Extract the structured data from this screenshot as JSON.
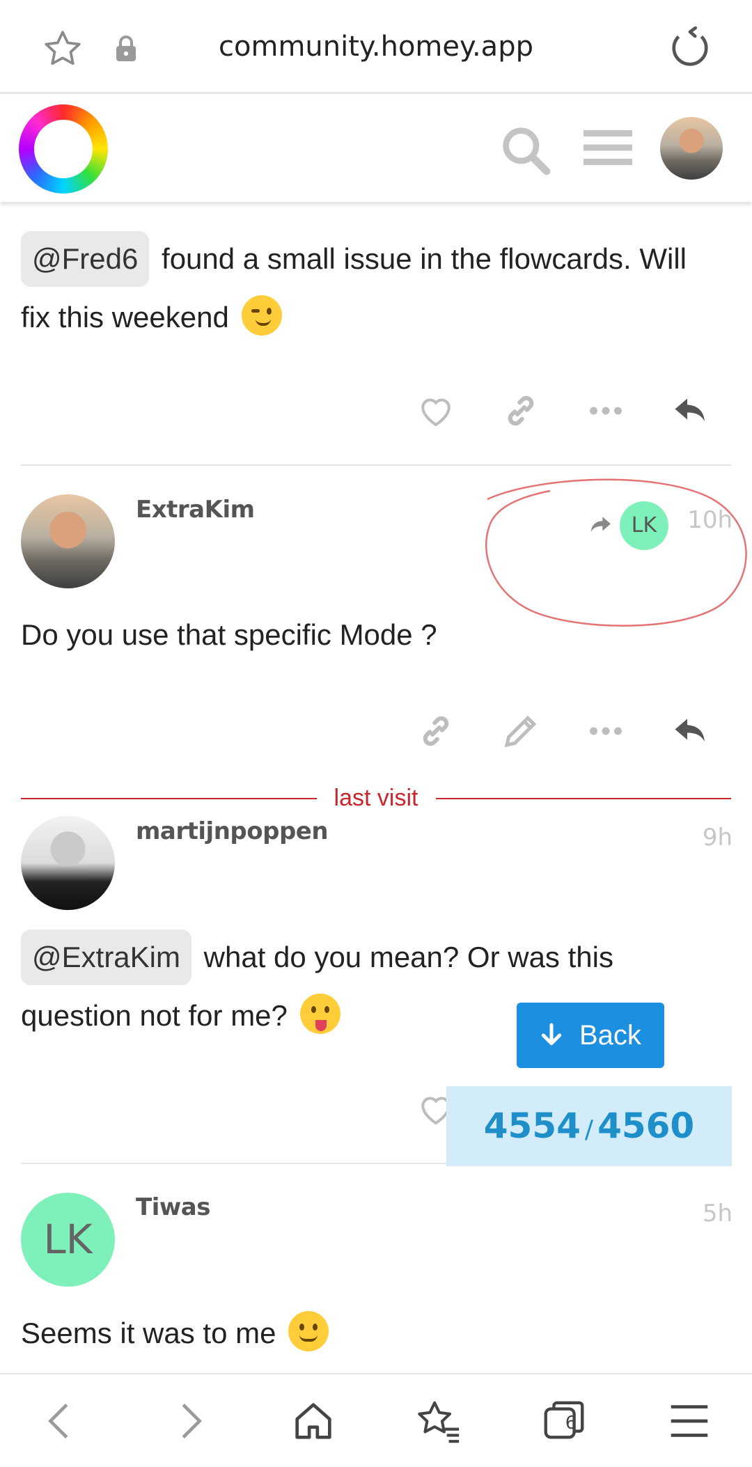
{
  "browser": {
    "url": "community.homey.app",
    "tab_count": "6"
  },
  "posts": [
    {
      "mention": "@Fred6",
      "text_line1": " found a small issue in the flowcards. Will",
      "text_line2": "fix this weekend",
      "emoji": "wink"
    },
    {
      "username": "ExtraKim",
      "reply_to_avatar": "LK",
      "timestamp": "10h",
      "text": "Do you use that specific Mode ?"
    },
    {
      "username": "martijnpoppen",
      "timestamp": "9h",
      "mention": "@ExtraKim",
      "text_line1": " what do you mean? Or was this",
      "text_line2": "question not for me?",
      "emoji": "tongue"
    },
    {
      "username": "Tiwas",
      "avatar_initials": "LK",
      "timestamp": "5h",
      "text": "Seems it was to me",
      "emoji": "smile"
    }
  ],
  "divider_label": "last visit",
  "back_button": "Back",
  "progress": {
    "current": "4554",
    "separator": "/",
    "total": "4560"
  },
  "colors": {
    "accent_blue": "#1d8fe1",
    "progress_bg": "#d2ecfa",
    "lastvisit_red": "#c8262c",
    "avatar_green": "#7ef0b9"
  }
}
